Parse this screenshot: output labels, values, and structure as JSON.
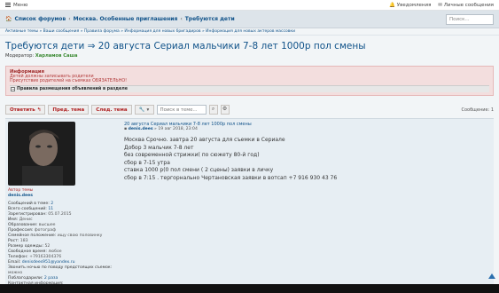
{
  "topbar": {
    "menu_label": "Меню",
    "notifications_label": "Уведомления",
    "messages_label": "Личные сообщения"
  },
  "navbar": {
    "crumbs": [
      "Список форумов",
      "Москва. Особенные приглашения",
      "Требуются дети"
    ],
    "search_placeholder": "Поиск..."
  },
  "subcrumb": "Активные темы » Ваши сообщения » Правила форума » Информация для новых бригадиров » Информация для новых актеров массовки",
  "topic": {
    "title": "Требуются дети ⇒ 20 августа Сериал мальчики 7-8 лет 1000р пол смены",
    "moderator_label": "Модератор:",
    "moderator_name": "Харламов Саша"
  },
  "info": {
    "heading": "Информация",
    "line1": "Детей должны записывать родители",
    "line2": "Присутствие родителей на съемках ОБЯЗАТЕЛЬНО!",
    "rules_label": "Правила размещения объявлений в разделе",
    "rules_box": "−"
  },
  "toolbar": {
    "reply_label": "Ответить",
    "prev_label": "Пред. тема",
    "next_label": "След. тема",
    "topic_search_placeholder": "Поиск в теме...",
    "messages_count": "Сообщение: 1"
  },
  "post": {
    "title": "20 августа Сериал мальчики 7-8 лет 1000р пол смены",
    "author": "denis.dees",
    "date": "» 19 авг 2018, 23:04",
    "lines": [
      "Москва Срочно. завтра 20 августа для съемки в Сериале",
      "Добор 3 мальчик 7-8 лет",
      "без современной стрижки( по сюжету 80-й год)",
      "сбор в 7-15 утра",
      "ставка 1000 р(0 пол смени ( 2 сцены) заявки в личку",
      "сбор в 7:15 . тергорнально Чертановская заявки в вотсап +7 916 930 43 76"
    ]
  },
  "profile": {
    "role_label": "Автор темы",
    "name": "denis.dees",
    "fields": [
      {
        "k": "Сообщений в теме:",
        "v": "2",
        "style": "link"
      },
      {
        "k": "Всего сообщений:",
        "v": "11",
        "style": "link"
      },
      {
        "k": "Зарегистрирован:",
        "v": "05.07.2015",
        "style": ""
      },
      {
        "k": "Имя:",
        "v": "Денис",
        "style": ""
      },
      {
        "k": "Образование:",
        "v": "высшее",
        "style": ""
      },
      {
        "k": "Профессия:",
        "v": "фотограф",
        "style": ""
      },
      {
        "k": "Семейное положение:",
        "v": "ищу свою половинку",
        "style": ""
      },
      {
        "k": "Рост:",
        "v": "183",
        "style": ""
      },
      {
        "k": "Размер одежды:",
        "v": "52",
        "style": ""
      },
      {
        "k": "Свободное время:",
        "v": "любое",
        "style": ""
      },
      {
        "k": "Телефон:",
        "v": "+79163304376",
        "style": ""
      },
      {
        "k": "Email:",
        "v": "denisdees951@yandex.ru",
        "style": "link"
      },
      {
        "k": "Звонить ночью по поводу предстоящих съемок:",
        "v": "можно",
        "style": ""
      },
      {
        "k": "Поблагодарили:",
        "v": "2 раза",
        "style": "link"
      },
      {
        "k": "Контактная информация:",
        "v": "",
        "style": ""
      }
    ]
  },
  "colors": {
    "link": "#105289",
    "accent_red": "#b02222",
    "info_bg": "#f3dede",
    "post_bg": "#e7eef3"
  }
}
